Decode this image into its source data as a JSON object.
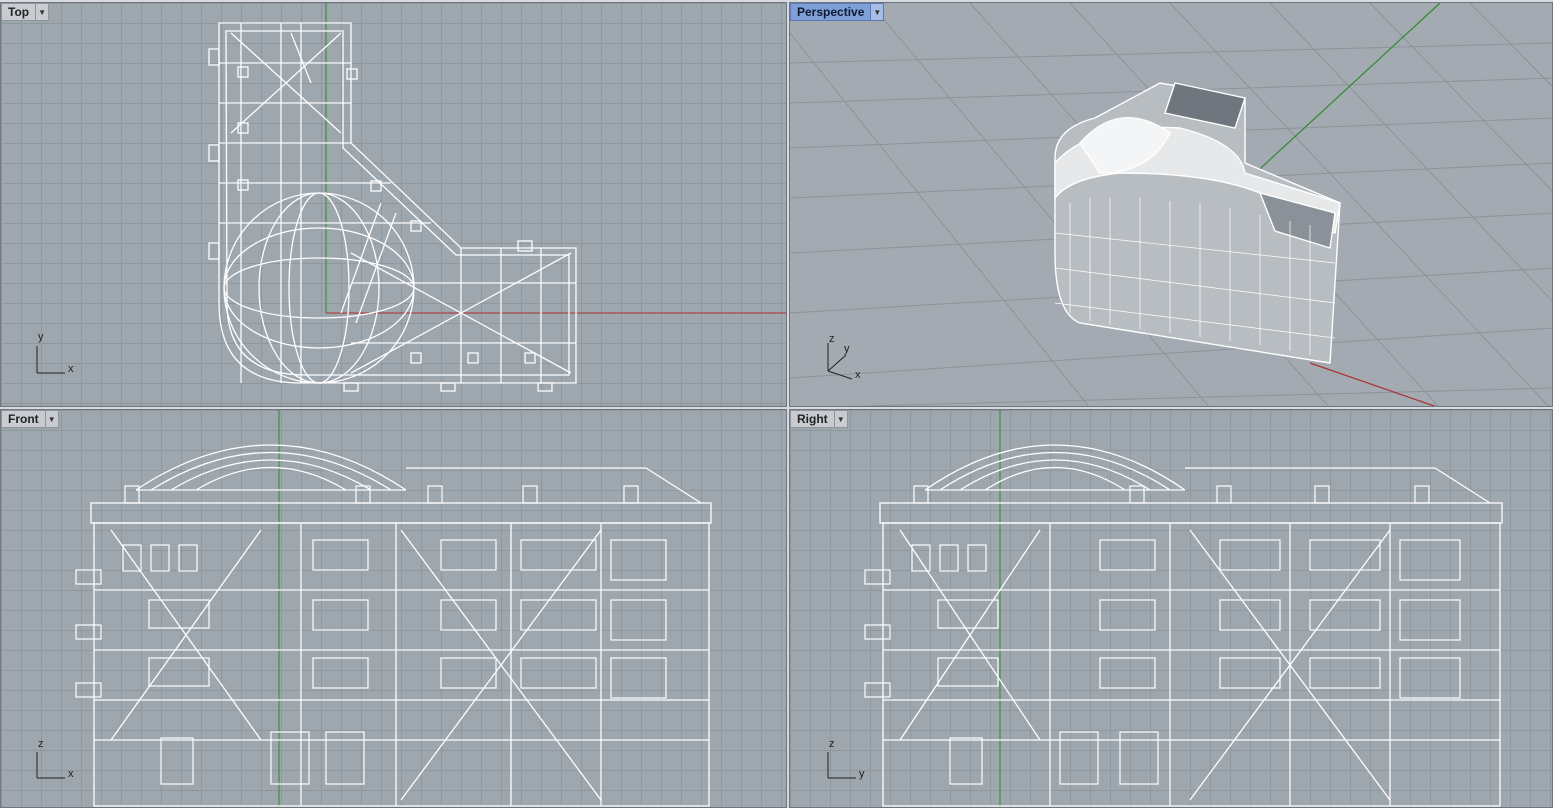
{
  "viewports": {
    "top": {
      "label": "Top",
      "axis1": "y",
      "axis2": "x"
    },
    "perspective": {
      "label": "Perspective",
      "axis1": "z",
      "axis2": "y",
      "axis3": "x"
    },
    "front": {
      "label": "Front",
      "axis1": "z",
      "axis2": "x"
    },
    "right": {
      "label": "Right",
      "axis1": "z",
      "axis2": "y"
    }
  },
  "icons": {
    "dropdown": "chevron-down-icon"
  },
  "colors": {
    "viewport_bg": "#9ea6ae",
    "grid_line": "#8f979f",
    "wireframe": "#ffffff",
    "x_axis": "#a83232",
    "y_axis": "#2e8b2e",
    "active_label": "#7f9fd8"
  }
}
